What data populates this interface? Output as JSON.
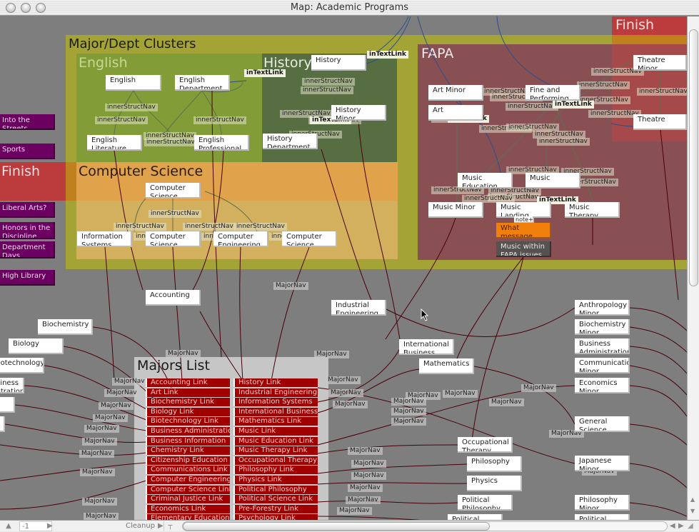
{
  "window": {
    "title": "Map: Academic Programs"
  },
  "colors": {
    "canvas_bg": "#7e7e7e",
    "cluster_bg": "#a3a336",
    "english_bg": "#829c38",
    "history_bg": "#576e42",
    "cs_header_bg": "#e0a24a",
    "cs_body_bg": "#d3b05e",
    "fapa_bg": "#895054",
    "finish_bg": "#bc3b3c",
    "sidebar_btn_bg": "#6b0060",
    "majors_list_bg": "#c6c6c6",
    "link_item_bg": "#a00000",
    "orange_note": "#f07f0c",
    "dark_note": "#555250",
    "major_nav_line": "#4a0008",
    "inner_nav_line": "#5c7050",
    "text_link_line": "#2a4f8c"
  },
  "regions": {
    "clusters_title": "Major/Dept Clusters",
    "english_title": "English",
    "history_title": "History",
    "fapa_title": "FAPA",
    "cs_title": "Computer Science",
    "finish_top": "Finish",
    "finish_left": "Finish",
    "majors_list_title": "Majors List"
  },
  "sidebar": {
    "items": [
      {
        "label": "Into the Streets"
      },
      {
        "label": "Sports"
      },
      {
        "label": "Liberal Arts?"
      },
      {
        "label": "Honors in the Discipline"
      },
      {
        "label": "Department Days"
      },
      {
        "label": "High Library"
      }
    ]
  },
  "nodes": {
    "english": [
      {
        "label": "English"
      },
      {
        "label": "English Department"
      },
      {
        "label": "English Literature"
      },
      {
        "label": "English Professional"
      }
    ],
    "history": [
      {
        "label": "History"
      },
      {
        "label": "History Minor"
      },
      {
        "label": "History Department"
      }
    ],
    "cs": [
      {
        "label": "Computer Science"
      },
      {
        "label": "Information Systems"
      },
      {
        "label": "Computer Science"
      },
      {
        "label": "Computer Engineering"
      },
      {
        "label": "Computer Science Minor"
      }
    ],
    "fapa": [
      {
        "label": "Art Minor"
      },
      {
        "label": "Art"
      },
      {
        "label": "Fine and Performing"
      },
      {
        "label": "Theatre Minor"
      },
      {
        "label": "Theatre"
      },
      {
        "label": "Music Education"
      },
      {
        "label": "Music"
      },
      {
        "label": "Music Minor"
      },
      {
        "label": "Music Landing"
      },
      {
        "label": "Music Therapy"
      }
    ],
    "notes": {
      "orange": "What message here?",
      "dark": "Music within FAPA issues",
      "small": "note+"
    },
    "majors_left": [
      {
        "label": "Accounting"
      },
      {
        "label": "Biochemistry"
      },
      {
        "label": "Biology"
      },
      {
        "label": "Biotechnology"
      },
      {
        "label": "Business Administration"
      },
      {
        "label": ""
      },
      {
        "label": ""
      }
    ],
    "majors_center": [
      {
        "label": "Industrial Engineering"
      },
      {
        "label": "International Business"
      },
      {
        "label": "Mathematics"
      },
      {
        "label": "Occupational Therapy"
      },
      {
        "label": "Philosophy"
      },
      {
        "label": "Physics"
      },
      {
        "label": "Political Philosophy"
      },
      {
        "label": "Political"
      }
    ],
    "minors_right": [
      {
        "label": "Anthropology Minor"
      },
      {
        "label": "Biochemistry Minor"
      },
      {
        "label": "Business Administration"
      },
      {
        "label": "Communications Minor"
      },
      {
        "label": "Economics Minor"
      },
      {
        "label": "General Science Minor"
      },
      {
        "label": "Japanese Minor"
      },
      {
        "label": "Philosophy Minor"
      },
      {
        "label": "Political"
      }
    ]
  },
  "link_tags": {
    "inner": "innerStructNav",
    "text": "inTextLink",
    "major": "MajorNav"
  },
  "majors_list": {
    "col1": [
      "Accounting Link",
      "Art Link",
      "Biochemistry Link",
      "Biology Link",
      "Biotechnology Link",
      "Business Administration",
      "Business Information",
      "Chemistry Link",
      "Citizenship Education",
      "Communications Link",
      "Computer Engineering",
      "Computer Science Link",
      "Criminal Justice Link",
      "Economics Link",
      "Elementary Education"
    ],
    "col2": [
      "History Link",
      "Industrial Engineering",
      "Information Systems",
      "International Business",
      "Mathematics Link",
      "Music Link",
      "Music Education Link",
      "Music Therapy Link",
      "Occupational Therapy",
      "Philosophy Link",
      "Physics Link",
      "Political Philosophy",
      "Political Science Link",
      "Pre-Forestry Link",
      "Psychology Link"
    ]
  },
  "bottom_bar": {
    "level_value": "-1",
    "cleanup_label": "Cleanup"
  }
}
